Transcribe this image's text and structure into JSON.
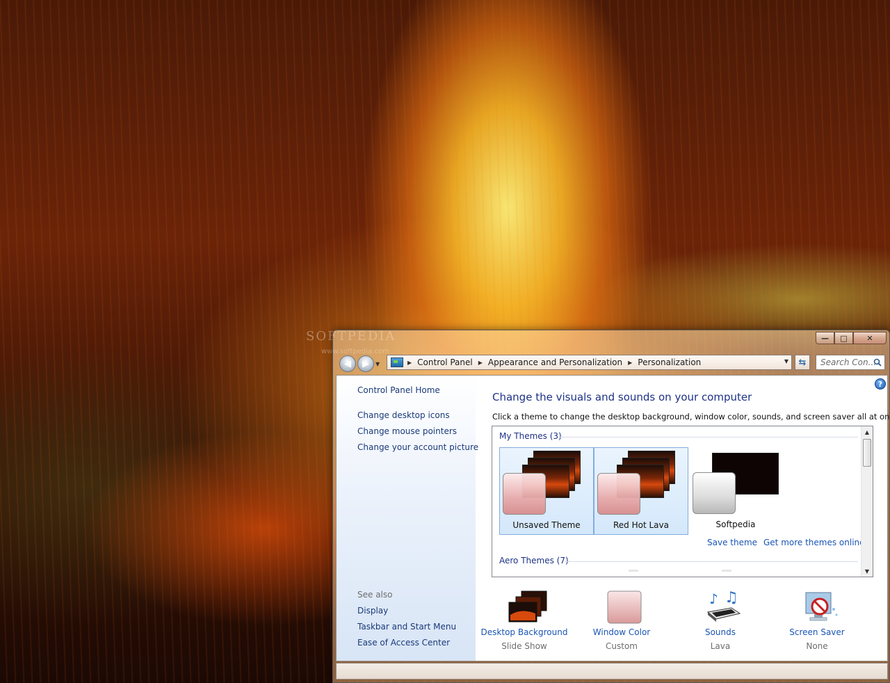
{
  "wallpaper": {
    "watermark": "SOFTPEDIA",
    "watermark_sub": "www.softpedia.com",
    "colors": {
      "lava_core": "#ffd23c",
      "lava_edge": "#d7490d",
      "night": "#1c0904"
    }
  },
  "window": {
    "caption_buttons": {
      "minimize": "—",
      "maximize": "□",
      "close": "✕"
    },
    "nav": {
      "back_icon": "arrow-left-icon",
      "forward_icon": "arrow-right-icon"
    },
    "address": {
      "crumbs": [
        "Control Panel",
        "Appearance and Personalization",
        "Personalization"
      ]
    },
    "search": {
      "placeholder": "Search Con..."
    },
    "accent": "#1e3287",
    "link_color": "#1a55b5"
  },
  "sidebar": {
    "home": "Control Panel Home",
    "links": [
      "Change desktop icons",
      "Change mouse pointers",
      "Change your account picture"
    ],
    "see_also_label": "See also",
    "see_also": [
      "Display",
      "Taskbar and Start Menu",
      "Ease of Access Center"
    ]
  },
  "main": {
    "help": "?",
    "title": "Change the visuals and sounds on your computer",
    "description": "Click a theme to change the desktop background, window color, sounds, and screen saver all at once.",
    "groups": {
      "my_themes": "My Themes (3)",
      "aero_themes": "Aero Themes (7)"
    },
    "themes": [
      {
        "label": "Unsaved Theme"
      },
      {
        "label": "Red Hot Lava",
        "selected": true
      },
      {
        "label": "Softpedia"
      }
    ],
    "save_theme": "Save theme",
    "more_themes": "Get more themes online",
    "options": [
      {
        "label": "Desktop Background",
        "value": "Slide Show",
        "icon": "desktop-background-icon"
      },
      {
        "label": "Window Color",
        "value": "Custom",
        "icon": "window-color-icon"
      },
      {
        "label": "Sounds",
        "value": "Lava",
        "icon": "sounds-icon"
      },
      {
        "label": "Screen Saver",
        "value": "None",
        "icon": "screen-saver-icon"
      }
    ]
  }
}
